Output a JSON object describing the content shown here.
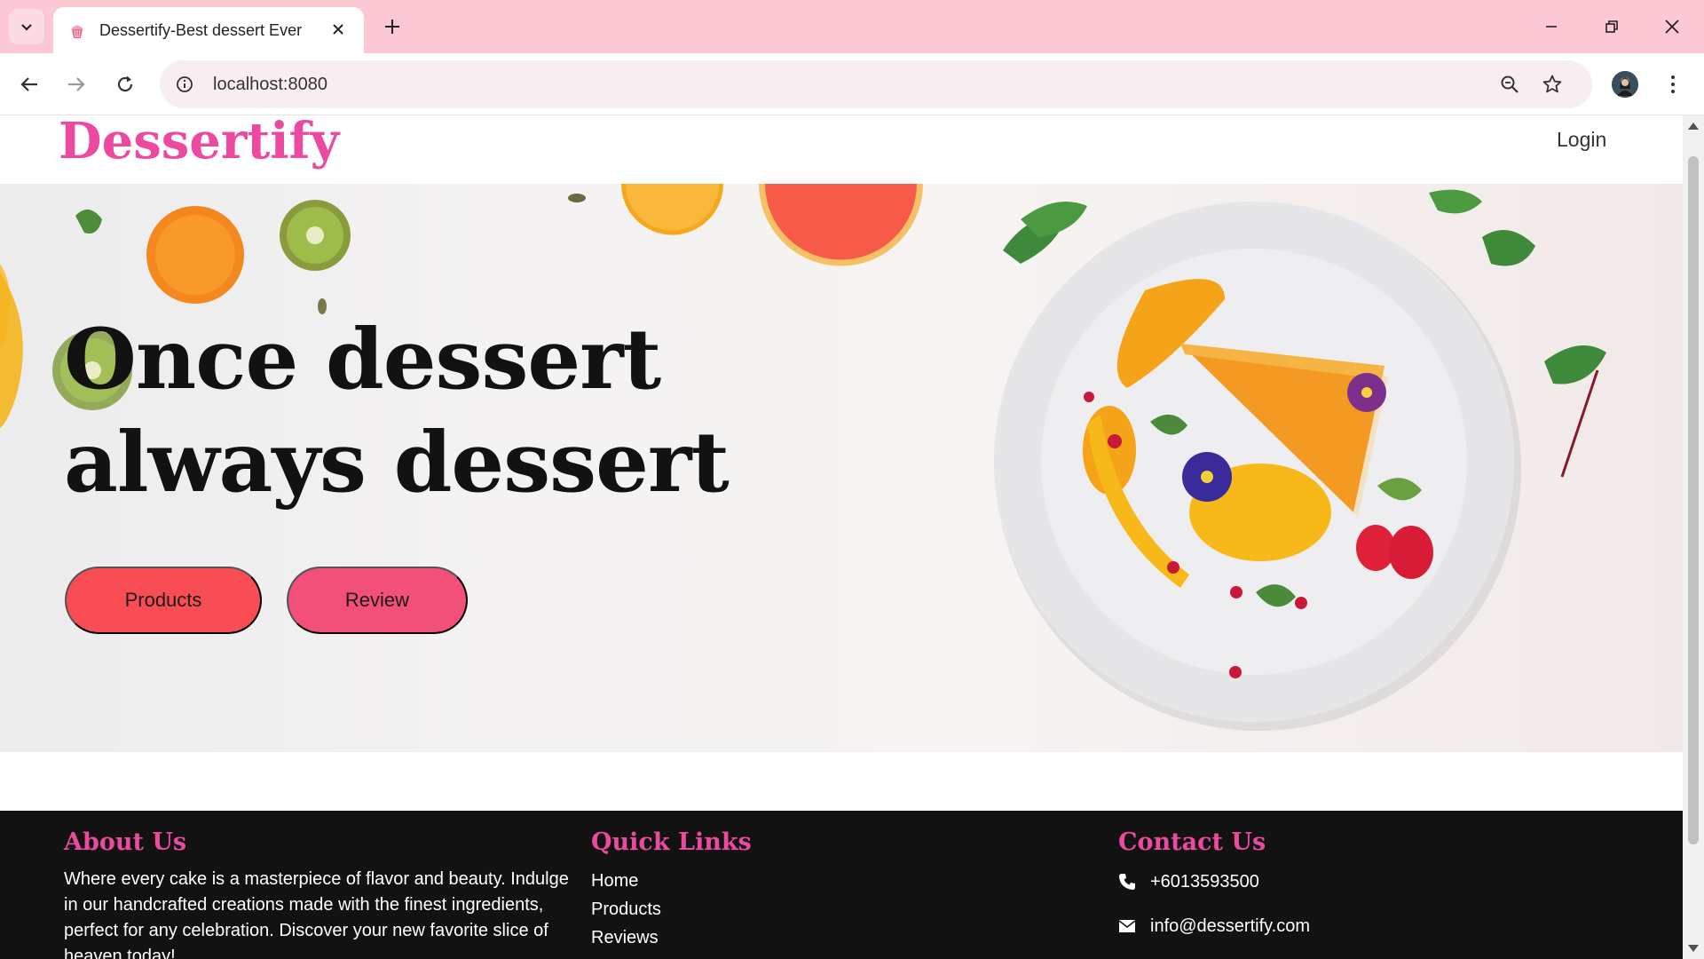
{
  "browser": {
    "tab_title": "Dessertify-Best dessert Ever",
    "url": "localhost:8080"
  },
  "header": {
    "logo": "Dessertify",
    "login": "Login"
  },
  "hero": {
    "title": "Once dessert always dessert",
    "buttons": [
      "Products",
      "Review"
    ]
  },
  "footer": {
    "about": {
      "heading": "About Us",
      "text": "Where every cake is a masterpiece of flavor and beauty. Indulge in our handcrafted creations made with the finest ingredients, perfect for any celebration. Discover your new favorite slice of heaven today!"
    },
    "quick_links": {
      "heading": "Quick Links",
      "items": [
        "Home",
        "Products",
        "Reviews"
      ]
    },
    "contact": {
      "heading": "Contact Us",
      "phone": "+6013593500",
      "email": "info@dessertify.com"
    }
  },
  "colors": {
    "brand_pink": "#ec4aa0",
    "products_button": "#f84d55",
    "review_button": "#f25079",
    "footer_bg": "#121212",
    "tabbar_bg": "#fcc8d4"
  },
  "icons": [
    "chevron-down-icon",
    "cupcake-icon",
    "close-icon",
    "plus-icon",
    "minimize-icon",
    "restore-icon",
    "back-icon",
    "forward-icon",
    "reload-icon",
    "info-icon",
    "zoom-icon",
    "star-icon",
    "phone-icon",
    "mail-icon"
  ]
}
